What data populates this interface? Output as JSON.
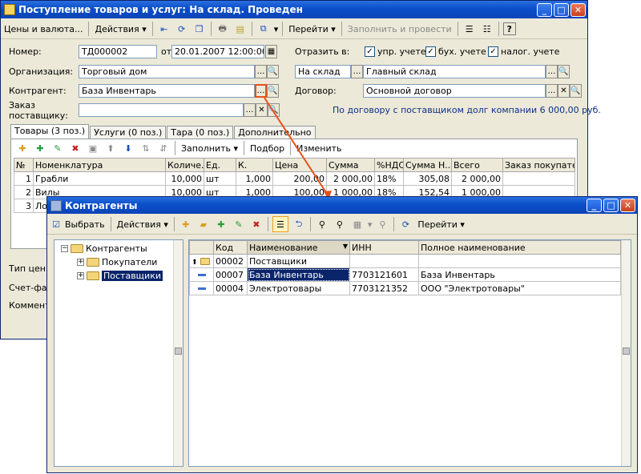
{
  "doc": {
    "title": "Поступление товаров и услуг: На склад. Проведен",
    "toolbar": {
      "prices_currency": "Цены и валюта...",
      "actions": "Действия",
      "go": "Перейти",
      "fill_and_post": "Заполнить и провести",
      "help": "?"
    },
    "form": {
      "number_label": "Номер:",
      "number": "ТД000002",
      "from_label": "от:",
      "date": "20.01.2007 12:00:00",
      "reflect_label": "Отразить в:",
      "cb_management": "упр. учете",
      "cb_accounting": "бух. учете",
      "cb_tax": "налог. учете",
      "org_label": "Организация:",
      "org": "Торговый дом",
      "warehouse_type": "На склад",
      "warehouse": "Главный склад",
      "contractor_label": "Контрагент:",
      "contractor": "База Инвентарь",
      "contract_label": "Договор:",
      "contract": "Основной договор",
      "order_label_1": "Заказ",
      "order_label_2": "поставщику:",
      "debt_info": "По договору с поставщиком долг компании 6 000,00 руб.",
      "price_type_label": "Тип цен:",
      "invoice_label": "Счет-фак",
      "comment_label": "Коммент"
    },
    "tabs": [
      "Товары (3 поз.)",
      "Услуги (0 поз.)",
      "Тара (0 поз.)",
      "Дополнительно"
    ],
    "tab_toolbar": {
      "fill": "Заполнить",
      "selection": "Подбор",
      "change": "Изменить"
    },
    "table": {
      "columns": [
        "№",
        "Номенклатура",
        "Количе...",
        "Ед.",
        "К.",
        "Цена",
        "Сумма",
        "%НДС",
        "Сумма Н...",
        "Всего",
        "Заказ покупател"
      ],
      "rows": [
        [
          "1",
          "Грабли",
          "10,000",
          "шт",
          "1,000",
          "200,00",
          "2 000,00",
          "18%",
          "305,08",
          "2 000,00",
          ""
        ],
        [
          "2",
          "Вилы",
          "10,000",
          "шт",
          "1,000",
          "100,00",
          "1 000,00",
          "18%",
          "152,54",
          "1 000,00",
          ""
        ],
        [
          "3",
          "Ло",
          "",
          "",
          "",
          "",
          "",
          "",
          "",
          "",
          ""
        ]
      ]
    }
  },
  "picker": {
    "title": "Контрагенты",
    "toolbar": {
      "select": "Выбрать",
      "actions": "Действия",
      "go": "Перейти"
    },
    "tree": {
      "root": "Контрагенты",
      "children": [
        "Покупатели",
        "Поставщики"
      ]
    },
    "columns": [
      "Код",
      "Наименование",
      "ИНН",
      "Полное наименование"
    ],
    "rows": [
      {
        "code": "00002",
        "name": "Поставщики",
        "inn": "",
        "full": ""
      },
      {
        "code": "00007",
        "name": "База Инвентарь",
        "inn": "7703121601",
        "full": "База Инвентарь"
      },
      {
        "code": "00004",
        "name": "Электротовары",
        "inn": "7703121352",
        "full": "ООО \"Электротовары\""
      }
    ]
  },
  "colors": {
    "title_bar": "#0a4ec8",
    "selection": "#0a246a",
    "highlight_arrow": "#e8501a"
  }
}
